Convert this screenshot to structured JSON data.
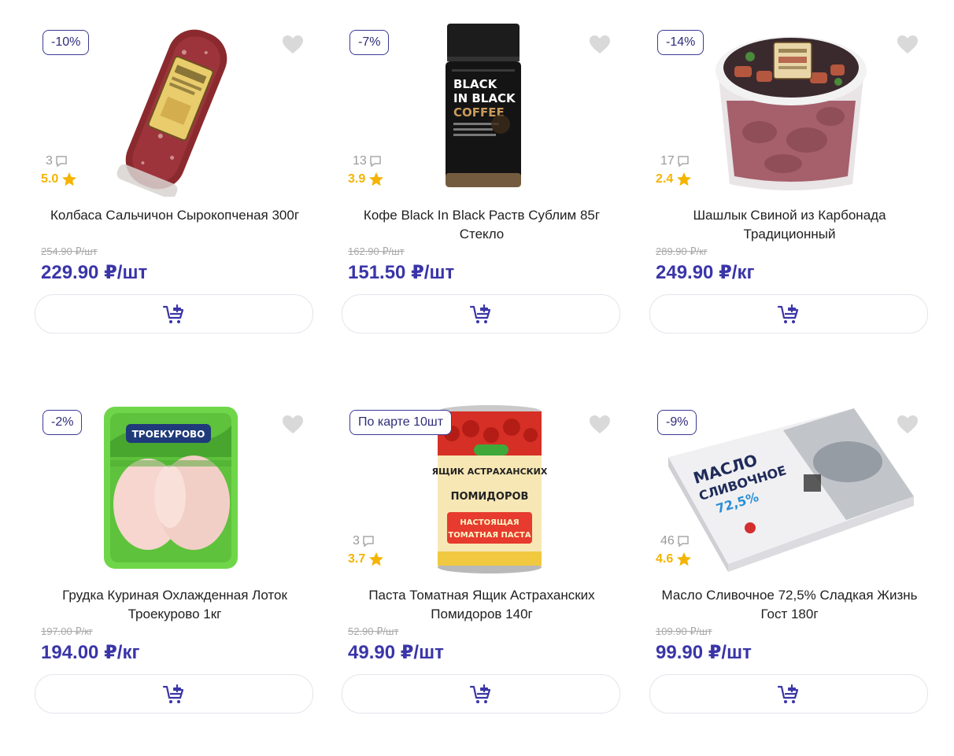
{
  "products": [
    {
      "badge": "-10%",
      "reviews": "3",
      "rating": "5.0",
      "name_line1": "Колбаса Сальчичон Сырокопченая 300г",
      "name_line2": "",
      "old_price": "254.90 ₽/шт",
      "price": "229.90 ₽/шт",
      "image": "sausage"
    },
    {
      "badge": "-7%",
      "reviews": "13",
      "rating": "3.9",
      "name_line1": "Кофе Black In Black Раств Сублим 85г",
      "name_line2": "Стекло",
      "old_price": "162.90 ₽/шт",
      "price": "151.50 ₽/шт",
      "image": "coffee-jar",
      "image_text": [
        "BLACK",
        "IN BLACK",
        "COFFEE"
      ]
    },
    {
      "badge": "-14%",
      "reviews": "17",
      "rating": "2.4",
      "name_line1": "Шашлык Свиной из Карбонада",
      "name_line2": "Традиционный",
      "old_price": "289.90 ₽/кг",
      "price": "249.90 ₽/кг",
      "image": "shashlik-bucket"
    },
    {
      "badge": "-2%",
      "reviews": "",
      "rating": "",
      "name_line1": "Грудка Куриная Охлажденная Лоток",
      "name_line2": "Троекурово 1кг",
      "old_price": "197.00 ₽/кг",
      "price": "194.00 ₽/кг",
      "image": "chicken-tray",
      "image_text": [
        "ТРОЕКУРОВО"
      ]
    },
    {
      "badge": "По карте 10шт",
      "reviews": "3",
      "rating": "3.7",
      "name_line1": "Паста Томатная Ящик Астраханских",
      "name_line2": "Помидоров 140г",
      "old_price": "52.90 ₽/шт",
      "price": "49.90 ₽/шт",
      "image": "tomato-can",
      "image_text": [
        "ЯЩИК АСТРАХАНСКИХ",
        "ПОМИДОРОВ",
        "НАСТОЯЩАЯ",
        "ТОМАТНАЯ ПАСТА"
      ]
    },
    {
      "badge": "-9%",
      "reviews": "46",
      "rating": "4.6",
      "name_line1": "Масло Сливочное 72,5% Сладкая Жизнь",
      "name_line2": "Гост 180г",
      "old_price": "109.90 ₽/шт",
      "price": "99.90 ₽/шт",
      "image": "butter-pack",
      "image_text": [
        "МАСЛО",
        "СЛИВОЧНОЕ",
        "72,5%"
      ]
    }
  ],
  "icons": {
    "favorite": "heart-icon",
    "reviews": "comment-icon",
    "rating": "star-icon",
    "cart": "add-to-cart-icon"
  },
  "colors": {
    "price": "#3a35a8",
    "badge_border": "#3b3a95",
    "star": "#f4b400",
    "old_price": "#a9a9a9"
  }
}
